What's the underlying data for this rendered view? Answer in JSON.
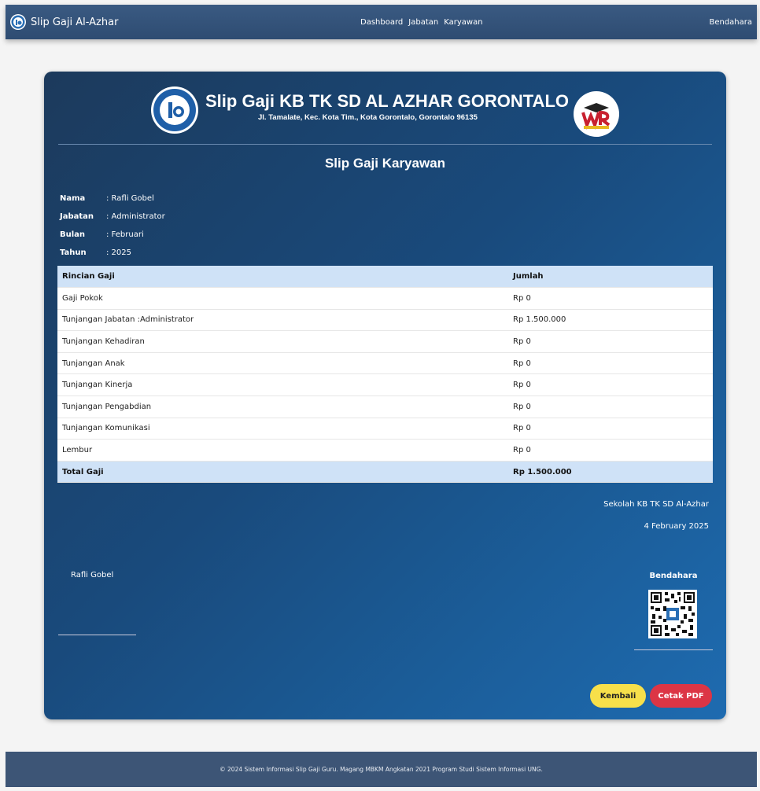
{
  "navbar": {
    "brand": "Slip Gaji Al-Azhar",
    "links": [
      "Dashboard",
      "Jabatan",
      "Karyawan"
    ],
    "user": "Bendahara"
  },
  "header": {
    "title": "Slip Gaji KB TK SD AL AZHAR GORONTALO",
    "address": "Jl. Tamalate, Kec. Kota Tim., Kota Gorontalo, Gorontalo 96135"
  },
  "document_title": "Slip Gaji Karyawan",
  "info": [
    {
      "label": "Nama",
      "value": ": Rafli Gobel"
    },
    {
      "label": "Jabatan",
      "value": ": Administrator"
    },
    {
      "label": "Bulan",
      "value": ": Februari"
    },
    {
      "label": "Tahun",
      "value": ": 2025"
    }
  ],
  "table": {
    "headers": [
      "Rincian Gaji",
      "Jumlah"
    ],
    "rows": [
      [
        "Gaji Pokok",
        "Rp 0"
      ],
      [
        "Tunjangan Jabatan :Administrator",
        "Rp 1.500.000"
      ],
      [
        "Tunjangan Kehadiran",
        "Rp 0"
      ],
      [
        "Tunjangan Anak",
        "Rp 0"
      ],
      [
        "Tunjangan Kinerja",
        "Rp 0"
      ],
      [
        "Tunjangan Pengabdian",
        "Rp 0"
      ],
      [
        "Tunjangan Komunikasi",
        "Rp 0"
      ],
      [
        "Lembur",
        "Rp 0"
      ]
    ],
    "total": [
      "Total Gaji",
      "Rp 1.500.000"
    ]
  },
  "signature": {
    "school": "Sekolah KB TK SD Al-Azhar",
    "date": "4 February 2025",
    "employee": "Rafli Gobel",
    "treasurer_label": "Bendahara"
  },
  "buttons": {
    "back": "Kembali",
    "pdf": "Cetak PDF"
  },
  "footer": "© 2024 Sistem Informasi Slip Gaji Guru. Magang MBKM Angkatan 2021 Program Studi Sistem Informasi UNG.",
  "colors": {
    "navbar": "#2e4c72",
    "card": "#1b5d99",
    "table_header": "#cfe2f7",
    "back_button": "#f7e04a",
    "pdf_button": "#dc3545",
    "footer": "#3d5576"
  }
}
